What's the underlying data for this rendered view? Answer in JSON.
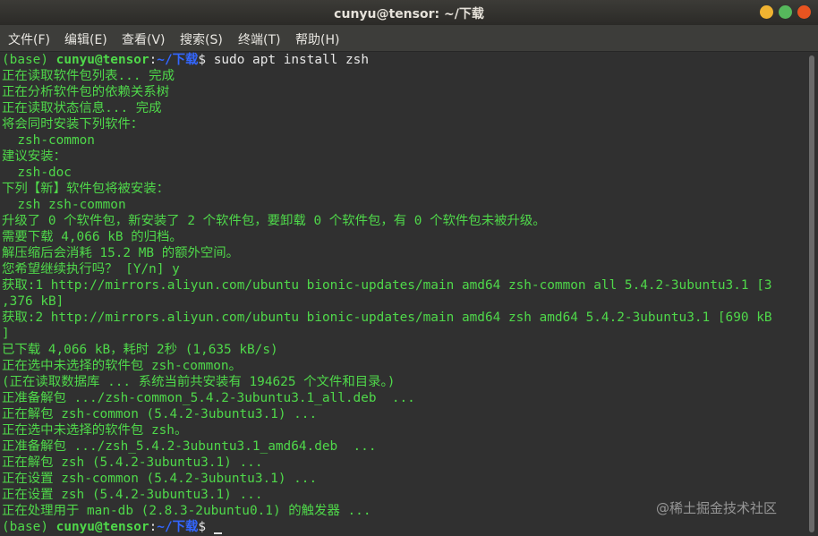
{
  "window": {
    "title": "cunyu@tensor: ~/下载"
  },
  "menu": [
    "文件(F)",
    "编辑(E)",
    "查看(V)",
    "搜索(S)",
    "终端(T)",
    "帮助(H)"
  ],
  "prompt": {
    "env": "(base) ",
    "user": "cunyu@tensor",
    "sep": ":",
    "dir": "~/下载",
    "dollar": "$ "
  },
  "command": "sudo apt install zsh",
  "output": [
    "正在读取软件包列表... 完成",
    "正在分析软件包的依赖关系树",
    "正在读取状态信息... 完成",
    "将会同时安装下列软件：",
    "  zsh-common",
    "建议安装：",
    "  zsh-doc",
    "下列【新】软件包将被安装：",
    "  zsh zsh-common",
    "升级了 0 个软件包，新安装了 2 个软件包，要卸载 0 个软件包，有 0 个软件包未被升级。",
    "需要下载 4,066 kB 的归档。",
    "解压缩后会消耗 15.2 MB 的额外空间。",
    "您希望继续执行吗？ [Y/n] y",
    "获取:1 http://mirrors.aliyun.com/ubuntu bionic-updates/main amd64 zsh-common all 5.4.2-3ubuntu3.1 [3",
    ",376 kB]",
    "获取:2 http://mirrors.aliyun.com/ubuntu bionic-updates/main amd64 zsh amd64 5.4.2-3ubuntu3.1 [690 kB",
    "]",
    "已下载 4,066 kB，耗时 2秒 (1,635 kB/s)",
    "正在选中未选择的软件包 zsh-common。",
    "(正在读取数据库 ... 系统当前共安装有 194625 个文件和目录。)",
    "正准备解包 .../zsh-common_5.4.2-3ubuntu3.1_all.deb  ...",
    "正在解包 zsh-common (5.4.2-3ubuntu3.1) ...",
    "正在选中未选择的软件包 zsh。",
    "正准备解包 .../zsh_5.4.2-3ubuntu3.1_amd64.deb  ...",
    "正在解包 zsh (5.4.2-3ubuntu3.1) ...",
    "正在设置 zsh-common (5.4.2-3ubuntu3.1) ...",
    "正在设置 zsh (5.4.2-3ubuntu3.1) ...",
    "正在处理用于 man-db (2.8.3-2ubuntu0.1) 的触发器 ..."
  ],
  "watermark": "@稀土掘金技术社区",
  "colors": {
    "output_green": "#4fd84a",
    "prompt_dir_blue": "#3366ff",
    "background": "#303030"
  }
}
